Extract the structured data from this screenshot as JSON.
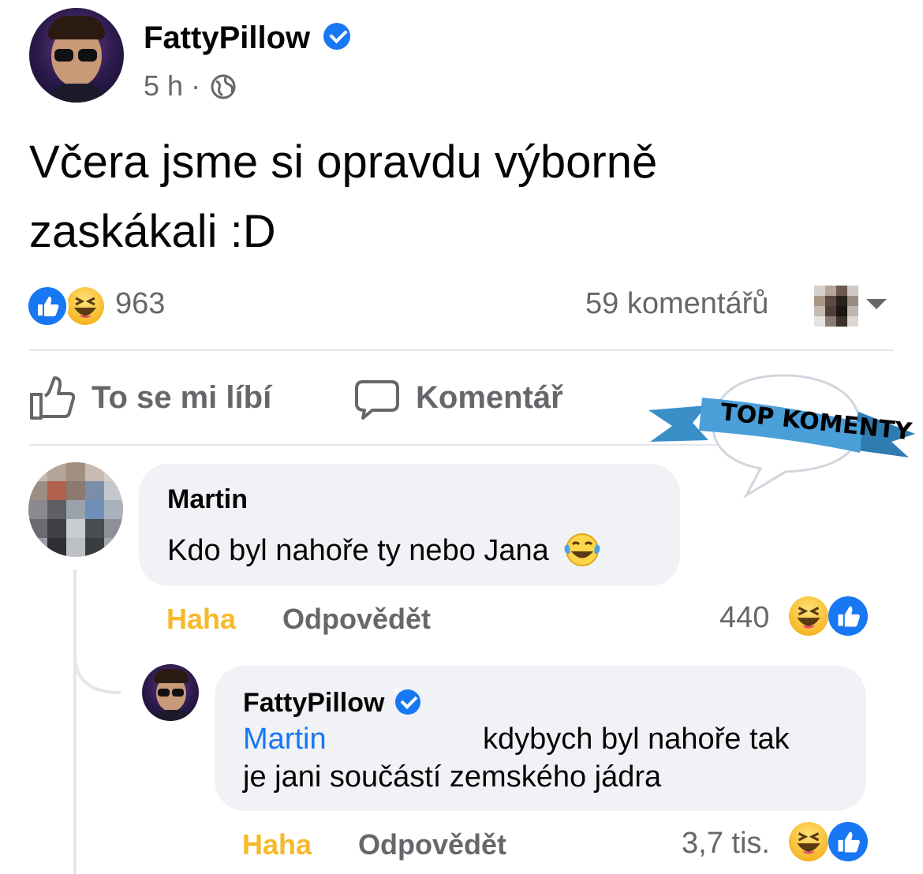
{
  "post": {
    "author": "FattyPillow",
    "time": "5 h",
    "separator": "·",
    "text_line1": "Včera jsme si opravdu výborně",
    "text_line2": "zaskákali :D",
    "reaction_count": "963",
    "comments_count": "59 komentářů"
  },
  "actions": {
    "like_label": "To se mi líbí",
    "comment_label": "Komentář"
  },
  "badge": {
    "label": "TOP KOMENTY"
  },
  "comments": [
    {
      "author": "Martin",
      "text": "Kdo byl nahoře ty nebo Jana",
      "haha_label": "Haha",
      "reply_label": "Odpovědět",
      "reaction_count": "440"
    },
    {
      "author": "FattyPillow",
      "mention": "Martin",
      "text_line1": "kdybych byl nahoře tak",
      "text_line2": "je jani součástí zemského jádra",
      "haha_label": "Haha",
      "reply_label": "Odpovědět",
      "reaction_count": "3,7 tis."
    }
  ],
  "colors": {
    "facebook_blue": "#1877f2",
    "haha_yellow": "#f7b928",
    "secondary_text": "#65676b",
    "bubble_bg": "#f0f2f5",
    "ribbon_blue": "#3a8fc9"
  },
  "icons": [
    "verified-badge-icon",
    "globe-icon",
    "like-reaction-icon",
    "haha-reaction-icon",
    "like-outline-icon",
    "comment-outline-icon",
    "chevron-down-icon",
    "crying-laughing-emoji-icon"
  ]
}
